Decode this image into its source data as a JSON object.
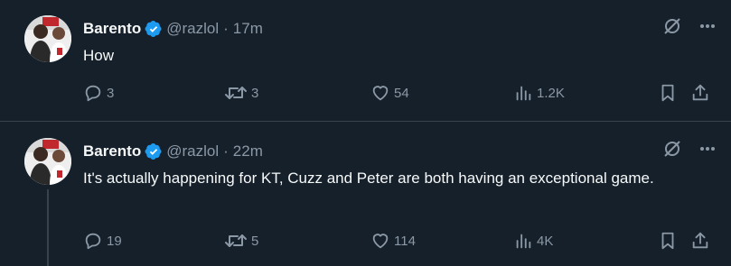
{
  "colors": {
    "background": "#15202b",
    "text": "#f7f9f9",
    "muted": "#8b98a5",
    "verified": "#1d9bf0",
    "divider": "#38444d"
  },
  "tweets": [
    {
      "name": "Barento",
      "handle": "@razlol",
      "separator": "·",
      "time": "17m",
      "text": "How",
      "replies": "3",
      "retweets": "3",
      "likes": "54",
      "views": "1.2K",
      "icons": [
        "grok-icon",
        "more-icon",
        "reply-icon",
        "retweet-icon",
        "like-icon",
        "views-icon",
        "bookmark-icon",
        "share-icon"
      ]
    },
    {
      "name": "Barento",
      "handle": "@razlol",
      "separator": "·",
      "time": "22m",
      "text": "It's actually happening for KT, Cuzz and Peter are both having an exceptional game.",
      "replies": "19",
      "retweets": "5",
      "likes": "114",
      "views": "4K",
      "icons": [
        "grok-icon",
        "more-icon",
        "reply-icon",
        "retweet-icon",
        "like-icon",
        "views-icon",
        "bookmark-icon",
        "share-icon"
      ]
    }
  ]
}
